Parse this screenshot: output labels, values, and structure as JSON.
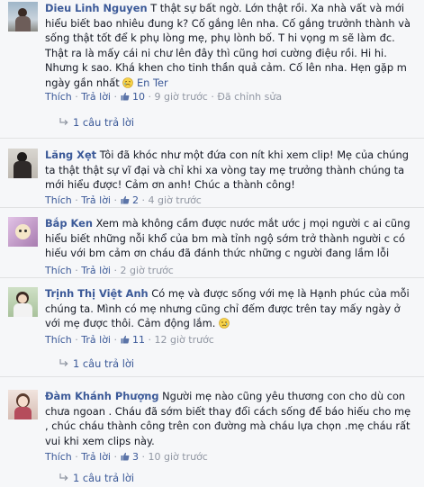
{
  "ui": {
    "like": "Thích",
    "reply": "Trả lời",
    "sep": "·",
    "edited": "Đã chỉnh sửa"
  },
  "comments": [
    {
      "author": "Dieu Linh Nguyen",
      "text": "T thật sự bất ngờ. Lớn thật rồi. Xa nhà vất và mới hiểu biết bao nhiêu đung k? Cố gắng lên nha. Cố gắng trưởnh thành và sống thật tốt để k phụ lòng mẹ, phụ lònh bố. T hi vọng m sẽ làm đc. Thật ra là mấy cái ni chư lên đây thì cũng hơi cường điệu rồi. Hi hi. Nhưng k sao. Khá khen cho tinh thần quả cảm. Cố lên nha. Hẹn gặp m ngày gần nhất",
      "emoji": "crying-face-icon",
      "translate": "En Ter",
      "likes": "10",
      "time": "9 giờ trước",
      "edited": true,
      "replies": "1 câu trả lời"
    },
    {
      "author": "Lăng Xẹt",
      "text": "Tôi đã khóc như một đứa con nít khi xem clip! Mẹ của chúng ta thật thật sự vĩ đại và chỉ khi xa vòng tay mẹ trưởng thành chúng ta mới hiểu được! Cảm ơn anh! Chúc a thành công!",
      "likes": "2",
      "time": "4 giờ trước"
    },
    {
      "author": "Bắp Ken",
      "text": "Xem mà không cầm được nước mắt ước j mọi người c ai cũng hiểu biết những nỗi khổ của bm mà tỉnh ngộ sớm trở thành người c có hiếu với bm cảm ơn cháu đã đánh thức những c người đang lầm lỗi",
      "time": "2 giờ trước"
    },
    {
      "author": "Trịnh Thị Việt Anh",
      "text": "Có mẹ và được sống với mẹ là Hạnh phúc của mỗi chúng ta. Mình có mẹ nhưng cũng chỉ đếm được trên tay mấy ngày ở với mẹ được thôi. Cảm động lắm.",
      "emoji": "sad-face-icon",
      "likes": "11",
      "time": "12 giờ trước",
      "replies": "1 câu trả lời"
    },
    {
      "author": "Đàm Khánh Phượng",
      "text": "Người mẹ nào cũng yêu thương con cho dù con chưa ngoan . Cháu đã sớm biết thay đổi cách sống để báo hiếu cho mẹ , chúc cháu thành công trên con đường mà cháu lựa chọn .mẹ cháu rất vui khi xem clips này.",
      "likes": "3",
      "time": "10 giờ trước",
      "replies": "1 câu trả lời"
    }
  ]
}
